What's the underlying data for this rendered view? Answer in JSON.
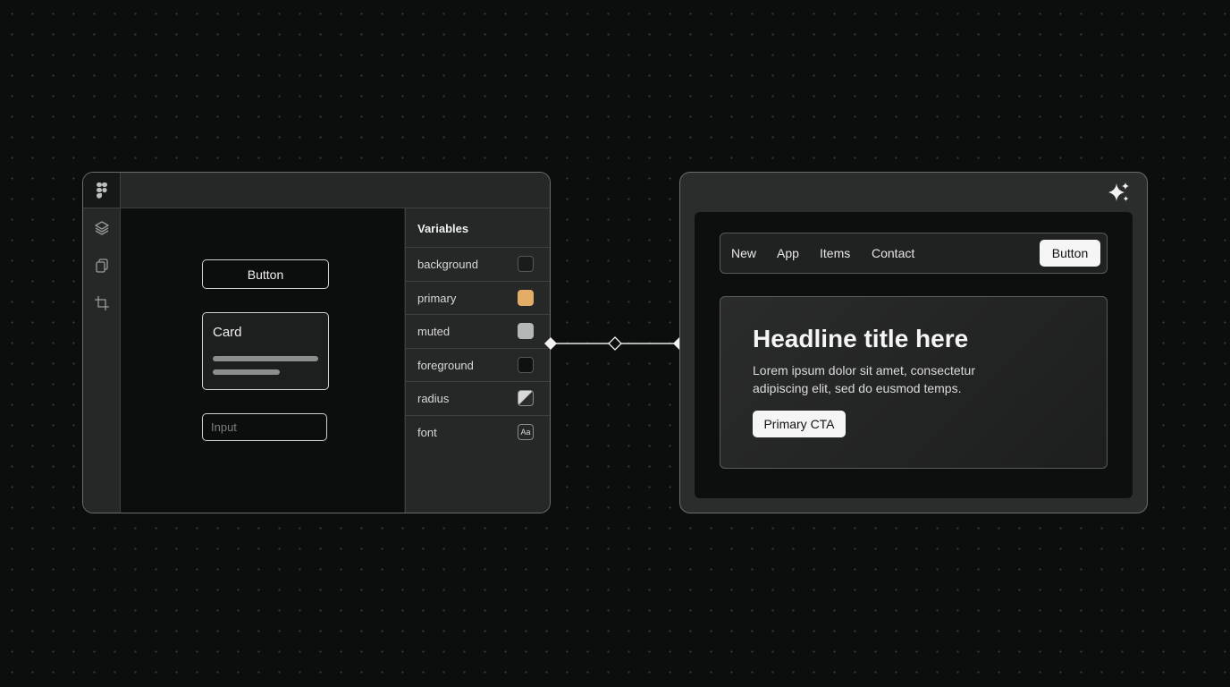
{
  "colors": {
    "page_bg": "#0c0d0d",
    "primary_swatch": "#e3ad67",
    "background_swatch": "#1a1b1b",
    "muted_swatch": "#b5b6b6",
    "foreground_swatch": "#0f1010",
    "accent_white": "#f5f5f5"
  },
  "design_tool": {
    "logo_icon": "figma-logo-icon",
    "sidebar_icons": [
      "layers-icon",
      "copy-icon",
      "crop-icon"
    ],
    "canvas": {
      "button_label": "Button",
      "card_title": "Card",
      "input_placeholder": "Input"
    },
    "variables": {
      "title": "Variables",
      "items": [
        {
          "name": "background",
          "kind": "color"
        },
        {
          "name": "primary",
          "kind": "color"
        },
        {
          "name": "muted",
          "kind": "color"
        },
        {
          "name": "foreground",
          "kind": "color"
        },
        {
          "name": "radius",
          "kind": "radius"
        },
        {
          "name": "font",
          "kind": "font",
          "glyph": "Aa"
        }
      ]
    }
  },
  "preview": {
    "sparkle_icon": "sparkles-icon",
    "nav": {
      "links": [
        "New",
        "App",
        "Items",
        "Contact"
      ],
      "button_label": "Button"
    },
    "hero": {
      "title": "Headline title here",
      "body": "Lorem ipsum dolor sit amet, consectetur adipiscing elit, sed do eusmod temps.",
      "cta_label": "Primary CTA"
    }
  }
}
